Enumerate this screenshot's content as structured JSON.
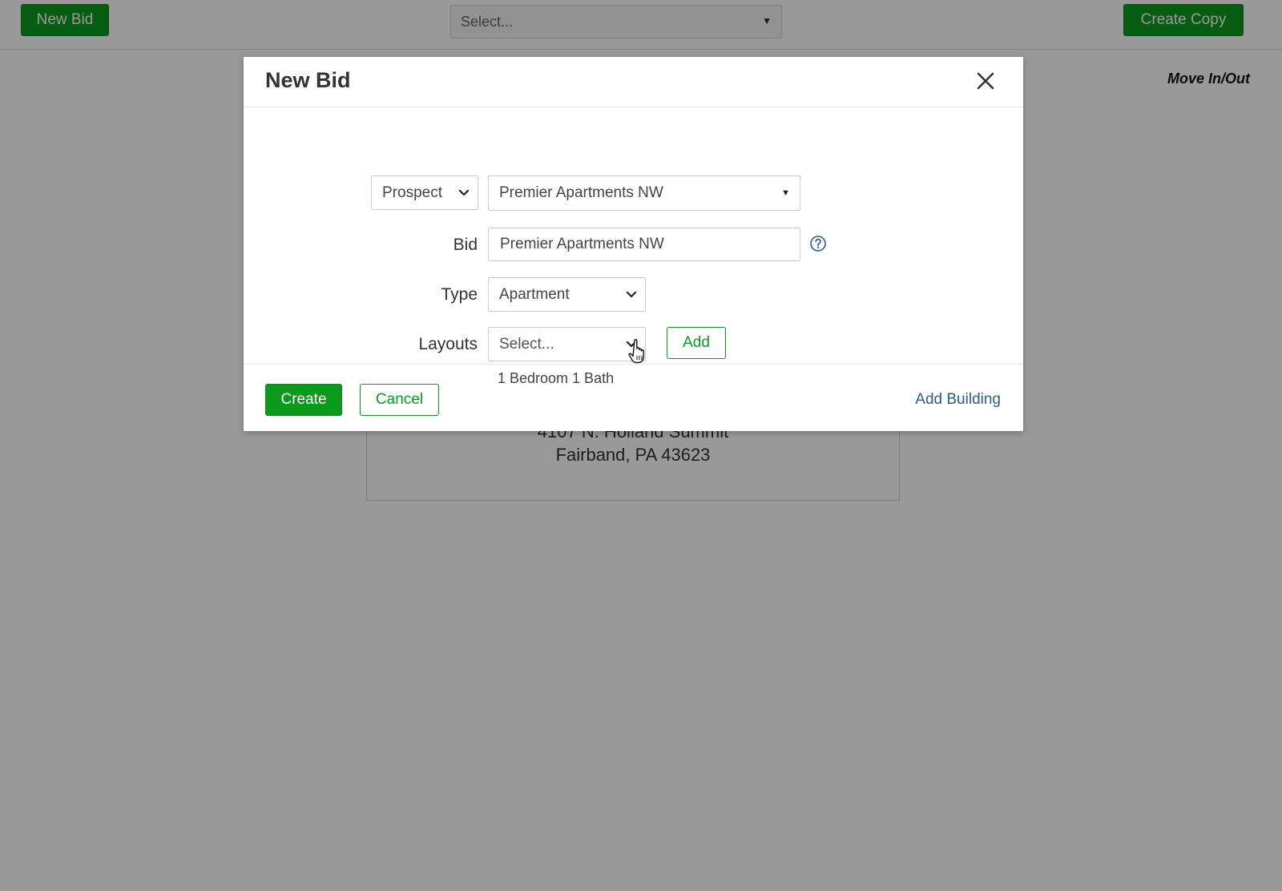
{
  "topbar": {
    "new_bid_label": "New Bid",
    "select_placeholder": "Select...",
    "create_copy_label": "Create Copy"
  },
  "page": {
    "move_inout": "Move In/Out",
    "address_line1": "4107 N. Holland Summit",
    "address_line2": "Fairband, PA 43623"
  },
  "modal": {
    "title": "New Bid",
    "contact_type": {
      "selected": "Prospect"
    },
    "customer": {
      "selected": "Premier Apartments NW"
    },
    "bid": {
      "label": "Bid",
      "value": "Premier Apartments NW"
    },
    "type": {
      "label": "Type",
      "selected": "Apartment"
    },
    "layouts": {
      "label": "Layouts",
      "placeholder": "Select...",
      "add_label": "Add",
      "items": [
        "1 Bedroom 1 Bath"
      ]
    },
    "footer": {
      "create_label": "Create",
      "cancel_label": "Cancel",
      "add_building_label": "Add Building"
    }
  },
  "colors": {
    "brand_green": "#0b9a1c",
    "link_blue": "#2a5d8a",
    "overlay": "rgba(0,0,0,0.40)"
  },
  "icons": {
    "close": "close-icon",
    "help": "help-icon",
    "chevron": "chevron-down-icon",
    "caret": "caret-down-icon",
    "cursor": "hand-pointer-icon"
  }
}
